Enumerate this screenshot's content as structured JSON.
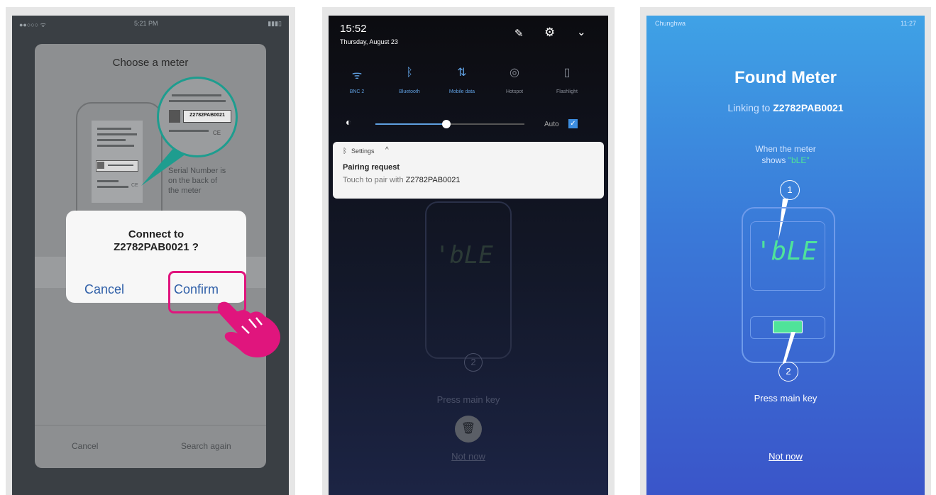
{
  "phone1": {
    "title": "Choose a meter",
    "serial_label": "Z2782PAB0021",
    "hint": [
      "Serial Number is",
      "on the back of",
      "the meter"
    ],
    "dialog": {
      "line1": "Connect to",
      "line2": "Z2782PAB0021 ?",
      "cancel": "Cancel",
      "confirm": "Confirm"
    },
    "bottom_cancel": "Cancel",
    "bottom_search": "Search again",
    "highlight_color": "#e0157d"
  },
  "phone2": {
    "time": "15:52",
    "date": "Thursday, August 23",
    "quick_settings": [
      {
        "icon": "wifi-icon",
        "label": "BNC 2"
      },
      {
        "icon": "bluetooth-icon",
        "label": "Bluetooth"
      },
      {
        "icon": "mobile-data-icon",
        "label": "Mobile data"
      },
      {
        "icon": "hotspot-icon",
        "label": "Hotspot"
      },
      {
        "icon": "flashlight-icon",
        "label": "Flashlight"
      }
    ],
    "brightness_auto": "Auto",
    "notification": {
      "app": "Settings",
      "title": "Pairing request",
      "body_prefix": "Touch to pair with",
      "serial": "Z2782PAB0021"
    },
    "meter_display": "'bLE",
    "step2": "2",
    "press_main_key": "Press main key",
    "not_now": "Not now"
  },
  "phone3": {
    "status_carrier": "Chunghwa",
    "status_time": "11:27",
    "title": "Found Meter",
    "linking_prefix": "Linking to",
    "serial": "Z2782PAB0021",
    "when_line1": "When the meter",
    "when_line2": "shows",
    "when_value": "\"bLE\"",
    "step1": "1",
    "step2": "2",
    "meter_display": "'bLE",
    "press_main_key": "Press main key",
    "not_now": "Not now",
    "accent_green": "#4fe39a"
  }
}
